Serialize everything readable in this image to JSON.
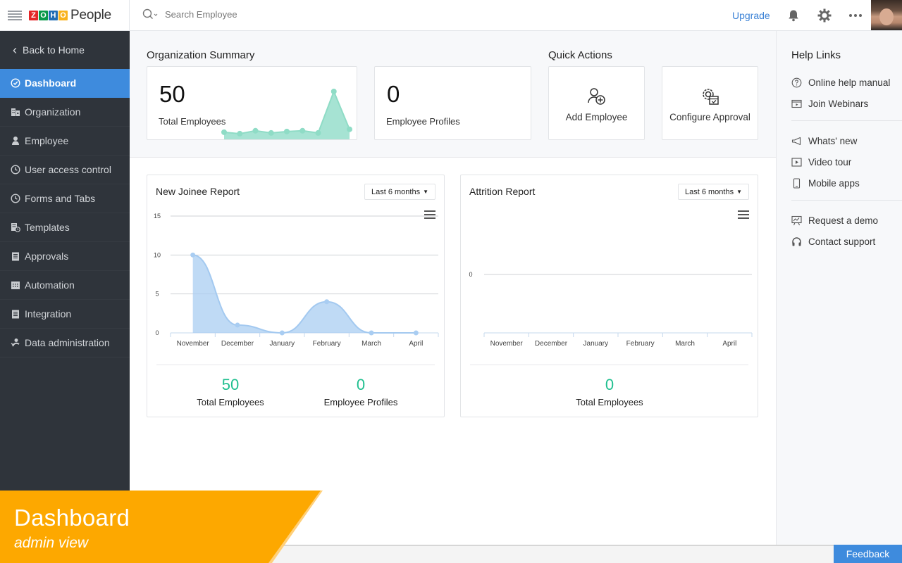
{
  "header": {
    "logo_letters": [
      "Z",
      "O",
      "H",
      "O"
    ],
    "logo_colors": [
      "#e42527",
      "#089949",
      "#226db4",
      "#f9b21d"
    ],
    "product_name": "People",
    "search_placeholder": "Search Employee",
    "upgrade_label": "Upgrade"
  },
  "sidebar": {
    "back_label": "Back to Home",
    "items": [
      {
        "label": "Dashboard",
        "icon": "dashboard-icon",
        "active": true
      },
      {
        "label": "Organization",
        "icon": "organization-icon"
      },
      {
        "label": "Employee",
        "icon": "employee-icon"
      },
      {
        "label": "User access control",
        "icon": "clock-icon"
      },
      {
        "label": "Forms and Tabs",
        "icon": "clock-icon"
      },
      {
        "label": "Templates",
        "icon": "templates-icon"
      },
      {
        "label": "Approvals",
        "icon": "clipboard-icon"
      },
      {
        "label": "Automation",
        "icon": "calendar-icon"
      },
      {
        "label": "Integration",
        "icon": "clipboard-icon"
      },
      {
        "label": "Data administration",
        "icon": "data-admin-icon"
      }
    ]
  },
  "summary": {
    "title": "Organization Summary",
    "total_employees": {
      "value": "50",
      "label": "Total Employees",
      "sparkline": [
        2,
        1,
        3,
        1.5,
        2.5,
        3,
        1.5,
        30,
        4
      ]
    },
    "employee_profiles": {
      "value": "0",
      "label": "Employee Profiles"
    }
  },
  "quick_actions": {
    "title": "Quick Actions",
    "items": [
      {
        "label": "Add Employee",
        "icon": "add-user-icon"
      },
      {
        "label": "Configure Approval",
        "icon": "configure-approval-icon"
      }
    ]
  },
  "reports": {
    "new_joinee": {
      "title": "New Joinee Report",
      "range_label": "Last 6 months",
      "metrics": [
        {
          "value": "50",
          "label": "Total Employees"
        },
        {
          "value": "0",
          "label": "Employee Profiles"
        }
      ]
    },
    "attrition": {
      "title": "Attrition Report",
      "range_label": "Last 6 months",
      "metrics": [
        {
          "value": "0",
          "label": "Total Employees"
        }
      ]
    }
  },
  "chart_data": [
    {
      "type": "area",
      "title": "New Joinee Report",
      "categories": [
        "November",
        "December",
        "January",
        "February",
        "March",
        "April"
      ],
      "series": [
        {
          "name": "New Joinees",
          "values": [
            10,
            1,
            0,
            4,
            0,
            0
          ]
        }
      ],
      "yticks": [
        "0",
        "5",
        "10",
        "15"
      ],
      "ylim": [
        0,
        15
      ],
      "grid": true,
      "color": "#a9cdf2"
    },
    {
      "type": "area",
      "title": "Attrition Report",
      "categories": [
        "November",
        "December",
        "January",
        "February",
        "March",
        "April"
      ],
      "series": [
        {
          "name": "Attrition",
          "values": [
            0,
            0,
            0,
            0,
            0,
            0
          ]
        }
      ],
      "yticks": [
        "0"
      ],
      "ylim": [
        0,
        0
      ],
      "grid": true,
      "color": "#a9cdf2"
    }
  ],
  "help": {
    "title": "Help Links",
    "links": [
      {
        "label": "Online help manual",
        "icon": "help-circle-icon"
      },
      {
        "label": "Join Webinars",
        "icon": "webinar-icon"
      },
      {
        "label": "Whats' new",
        "icon": "megaphone-icon"
      },
      {
        "label": "Video tour",
        "icon": "video-icon"
      },
      {
        "label": "Mobile apps",
        "icon": "mobile-icon"
      },
      {
        "label": "Request a demo",
        "icon": "presentation-icon"
      },
      {
        "label": "Contact support",
        "icon": "headset-icon"
      }
    ]
  },
  "banner": {
    "title": "Dashboard",
    "subtitle": "admin view",
    "color": "#fda800"
  },
  "feedback_label": "Feedback"
}
